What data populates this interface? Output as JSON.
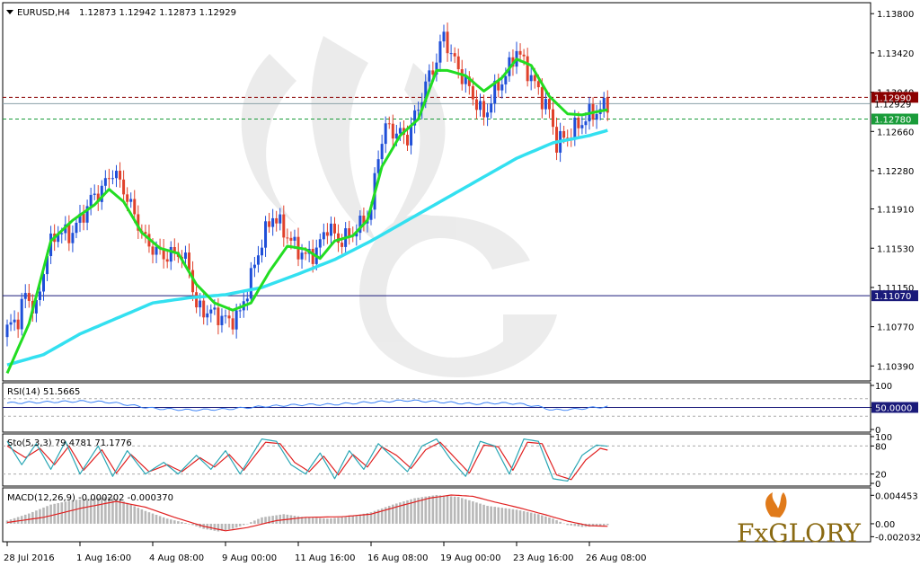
{
  "header": {
    "symbol": "EURUSD,H4",
    "ohlc": "1.12873 1.12942 1.12873 1.12929"
  },
  "brand": {
    "text": "FxGLORY"
  },
  "colors": {
    "bull": "#1f4fd8",
    "bear": "#e0412b",
    "ma_fast": "#22dd22",
    "ma_slow": "#33e0f0",
    "resistance": "#8b0000",
    "support_dashed": "#1a9c3a",
    "support_solid": "#1a1a7a",
    "rsi": "#3b82f6",
    "sto_main": "#2aa7b5",
    "sto_signal": "#e02020",
    "macd_hist": "#b8b8b8",
    "macd_signal": "#e02020"
  },
  "chart_data": [
    {
      "type": "candlestick",
      "ylim": [
        1.1028,
        1.1388
      ],
      "y_ticks": [
        "1.13800",
        "1.13420",
        "1.13040",
        "1.12660",
        "1.12280",
        "1.11910",
        "1.11530",
        "1.11150",
        "1.10770",
        "1.10390"
      ],
      "y_tick_values": [
        1.138,
        1.1342,
        1.1304,
        1.1266,
        1.1228,
        1.1191,
        1.1153,
        1.1115,
        1.1077,
        1.1039
      ],
      "x_ticks": [
        "28 Jul 2016",
        "1 Aug 16:00",
        "4 Aug 08:00",
        "9 Aug 00:00",
        "11 Aug 16:00",
        "16 Aug 08:00",
        "19 Aug 00:00",
        "23 Aug 16:00",
        "26 Aug 08:00"
      ],
      "x_tick_index": [
        0,
        20,
        40,
        60,
        80,
        100,
        120,
        140,
        160
      ],
      "levels": [
        {
          "name": "resistance",
          "value": 1.1299,
          "label": "1.12990",
          "style": "dashed"
        },
        {
          "name": "current",
          "value": 1.12929,
          "label": "1.12929",
          "style": "solid"
        },
        {
          "name": "support",
          "value": 1.1278,
          "label": "1.12780",
          "style": "dashed"
        },
        {
          "name": "support-2",
          "value": 1.1107,
          "label": "1.11070",
          "style": "solid"
        }
      ],
      "anchors": {
        "close": [
          [
            0,
            1.1075
          ],
          [
            3,
            1.1085
          ],
          [
            5,
            1.1108
          ],
          [
            8,
            1.1093
          ],
          [
            11,
            1.115
          ],
          [
            14,
            1.117
          ],
          [
            17,
            1.1165
          ],
          [
            20,
            1.118
          ],
          [
            23,
            1.12
          ],
          [
            26,
            1.121
          ],
          [
            29,
            1.1228
          ],
          [
            32,
            1.121
          ],
          [
            35,
            1.1185
          ],
          [
            38,
            1.116
          ],
          [
            41,
            1.115
          ],
          [
            44,
            1.1145
          ],
          [
            47,
            1.115
          ],
          [
            50,
            1.1135
          ],
          [
            52,
            1.1095
          ],
          [
            55,
            1.1092
          ],
          [
            58,
            1.1088
          ],
          [
            61,
            1.1082
          ],
          [
            64,
            1.109
          ],
          [
            67,
            1.1125
          ],
          [
            70,
            1.116
          ],
          [
            73,
            1.1185
          ],
          [
            76,
            1.117
          ],
          [
            79,
            1.1155
          ],
          [
            82,
            1.1145
          ],
          [
            85,
            1.115
          ],
          [
            88,
            1.1175
          ],
          [
            91,
            1.116
          ],
          [
            94,
            1.1165
          ],
          [
            97,
            1.1175
          ],
          [
            100,
            1.119
          ],
          [
            102,
            1.1245
          ],
          [
            104,
            1.127
          ],
          [
            107,
            1.1265
          ],
          [
            110,
            1.126
          ],
          [
            113,
            1.129
          ],
          [
            116,
            1.132
          ],
          [
            118,
            1.1335
          ],
          [
            120,
            1.136
          ],
          [
            122,
            1.134
          ],
          [
            125,
            1.132
          ],
          [
            128,
            1.13
          ],
          [
            131,
            1.128
          ],
          [
            134,
            1.1305
          ],
          [
            137,
            1.132
          ],
          [
            140,
            1.1345
          ],
          [
            143,
            1.1325
          ],
          [
            146,
            1.1305
          ],
          [
            149,
            1.1285
          ],
          [
            151,
            1.1255
          ],
          [
            154,
            1.1262
          ],
          [
            157,
            1.1272
          ],
          [
            160,
            1.1282
          ],
          [
            163,
            1.1287
          ],
          [
            165,
            1.1293
          ]
        ],
        "ma_fast": [
          [
            0,
            1.1032
          ],
          [
            6,
            1.108
          ],
          [
            12,
            1.116
          ],
          [
            18,
            1.118
          ],
          [
            24,
            1.1195
          ],
          [
            28,
            1.121
          ],
          [
            32,
            1.1198
          ],
          [
            37,
            1.1168
          ],
          [
            42,
            1.1153
          ],
          [
            47,
            1.1148
          ],
          [
            52,
            1.1118
          ],
          [
            57,
            1.11
          ],
          [
            62,
            1.1093
          ],
          [
            67,
            1.11
          ],
          [
            72,
            1.113
          ],
          [
            77,
            1.1155
          ],
          [
            82,
            1.1152
          ],
          [
            86,
            1.1143
          ],
          [
            90,
            1.116
          ],
          [
            95,
            1.1165
          ],
          [
            99,
            1.118
          ],
          [
            103,
            1.1232
          ],
          [
            108,
            1.1262
          ],
          [
            113,
            1.1278
          ],
          [
            118,
            1.1325
          ],
          [
            121,
            1.1325
          ],
          [
            126,
            1.132
          ],
          [
            131,
            1.1305
          ],
          [
            136,
            1.1318
          ],
          [
            140,
            1.1336
          ],
          [
            144,
            1.133
          ],
          [
            149,
            1.13
          ],
          [
            154,
            1.1283
          ],
          [
            158,
            1.1282
          ],
          [
            162,
            1.1285
          ],
          [
            165,
            1.1287
          ]
        ],
        "ma_slow": [
          [
            0,
            1.104
          ],
          [
            10,
            1.105
          ],
          [
            20,
            1.107
          ],
          [
            30,
            1.1085
          ],
          [
            40,
            1.11
          ],
          [
            50,
            1.1105
          ],
          [
            60,
            1.1108
          ],
          [
            70,
            1.1115
          ],
          [
            80,
            1.1128
          ],
          [
            90,
            1.1142
          ],
          [
            100,
            1.116
          ],
          [
            110,
            1.118
          ],
          [
            120,
            1.12
          ],
          [
            130,
            1.122
          ],
          [
            140,
            1.124
          ],
          [
            150,
            1.1255
          ],
          [
            160,
            1.1262
          ],
          [
            165,
            1.1267
          ]
        ]
      },
      "candle_count": 166
    },
    {
      "type": "line",
      "name": "RSI(14)",
      "label": "RSI(14) 51.5665",
      "ylim": [
        0,
        100
      ],
      "y_ticks": [
        "100",
        "50.0000",
        "0"
      ],
      "levels": [
        70,
        50,
        30
      ],
      "anchors": [
        [
          0,
          60
        ],
        [
          10,
          62
        ],
        [
          20,
          64
        ],
        [
          28,
          62
        ],
        [
          34,
          55
        ],
        [
          40,
          48
        ],
        [
          50,
          44
        ],
        [
          60,
          46
        ],
        [
          70,
          52
        ],
        [
          80,
          56
        ],
        [
          90,
          57
        ],
        [
          100,
          62
        ],
        [
          110,
          66
        ],
        [
          120,
          62
        ],
        [
          128,
          58
        ],
        [
          134,
          60
        ],
        [
          140,
          59
        ],
        [
          146,
          52
        ],
        [
          150,
          44
        ],
        [
          156,
          46
        ],
        [
          160,
          49
        ],
        [
          165,
          51.6
        ]
      ]
    },
    {
      "type": "line",
      "name": "Sto(5,3,3)",
      "label": "Sto(5,3,3) 79.4781 71.1776",
      "ylim": [
        0,
        100
      ],
      "y_ticks": [
        "100",
        "80",
        "20",
        "0"
      ],
      "levels": [
        80,
        20
      ],
      "main_anchors": [
        [
          0,
          90
        ],
        [
          4,
          40
        ],
        [
          8,
          85
        ],
        [
          12,
          30
        ],
        [
          16,
          90
        ],
        [
          20,
          20
        ],
        [
          25,
          80
        ],
        [
          29,
          15
        ],
        [
          33,
          70
        ],
        [
          38,
          20
        ],
        [
          43,
          45
        ],
        [
          47,
          20
        ],
        [
          52,
          60
        ],
        [
          56,
          30
        ],
        [
          60,
          70
        ],
        [
          64,
          20
        ],
        [
          70,
          95
        ],
        [
          74,
          90
        ],
        [
          78,
          40
        ],
        [
          82,
          20
        ],
        [
          86,
          65
        ],
        [
          90,
          10
        ],
        [
          94,
          70
        ],
        [
          98,
          30
        ],
        [
          102,
          85
        ],
        [
          106,
          55
        ],
        [
          110,
          25
        ],
        [
          114,
          80
        ],
        [
          118,
          95
        ],
        [
          122,
          50
        ],
        [
          126,
          15
        ],
        [
          130,
          90
        ],
        [
          134,
          80
        ],
        [
          138,
          20
        ],
        [
          142,
          95
        ],
        [
          146,
          90
        ],
        [
          150,
          10
        ],
        [
          154,
          5
        ],
        [
          158,
          60
        ],
        [
          162,
          82
        ],
        [
          165,
          79.5
        ]
      ],
      "signal_anchors": [
        [
          0,
          80
        ],
        [
          5,
          55
        ],
        [
          9,
          75
        ],
        [
          13,
          40
        ],
        [
          17,
          80
        ],
        [
          21,
          28
        ],
        [
          26,
          72
        ],
        [
          30,
          22
        ],
        [
          34,
          62
        ],
        [
          39,
          25
        ],
        [
          44,
          40
        ],
        [
          48,
          25
        ],
        [
          53,
          55
        ],
        [
          57,
          35
        ],
        [
          61,
          62
        ],
        [
          65,
          28
        ],
        [
          71,
          88
        ],
        [
          75,
          85
        ],
        [
          79,
          45
        ],
        [
          83,
          25
        ],
        [
          87,
          58
        ],
        [
          91,
          18
        ],
        [
          95,
          62
        ],
        [
          99,
          35
        ],
        [
          103,
          78
        ],
        [
          107,
          60
        ],
        [
          111,
          32
        ],
        [
          115,
          72
        ],
        [
          119,
          88
        ],
        [
          123,
          55
        ],
        [
          127,
          22
        ],
        [
          131,
          82
        ],
        [
          135,
          78
        ],
        [
          139,
          28
        ],
        [
          143,
          88
        ],
        [
          147,
          85
        ],
        [
          151,
          18
        ],
        [
          155,
          8
        ],
        [
          159,
          50
        ],
        [
          163,
          75
        ],
        [
          165,
          71.2
        ]
      ]
    },
    {
      "type": "bar",
      "name": "MACD(12,26,9)",
      "label": "MACD(12,26,9) -0.000202 -0.000370",
      "ylim": [
        -0.0024,
        0.0052
      ],
      "y_ticks": [
        "0.004453",
        "0.00",
        "-0.002032"
      ],
      "y_tick_values": [
        0.004453,
        0.0,
        -0.002032
      ],
      "hist_anchors": [
        [
          0,
          0.0005
        ],
        [
          6,
          0.0016
        ],
        [
          12,
          0.003
        ],
        [
          18,
          0.0037
        ],
        [
          24,
          0.004
        ],
        [
          28,
          0.0042
        ],
        [
          32,
          0.0035
        ],
        [
          38,
          0.002
        ],
        [
          44,
          0.0008
        ],
        [
          50,
          0.0
        ],
        [
          54,
          -0.0008
        ],
        [
          58,
          -0.0012
        ],
        [
          62,
          -0.0008
        ],
        [
          66,
          0.0
        ],
        [
          70,
          0.001
        ],
        [
          76,
          0.0015
        ],
        [
          82,
          0.001
        ],
        [
          88,
          0.0008
        ],
        [
          94,
          0.0011
        ],
        [
          100,
          0.0018
        ],
        [
          106,
          0.003
        ],
        [
          112,
          0.004
        ],
        [
          118,
          0.0045
        ],
        [
          124,
          0.0042
        ],
        [
          128,
          0.0035
        ],
        [
          132,
          0.0028
        ],
        [
          136,
          0.0025
        ],
        [
          140,
          0.0022
        ],
        [
          146,
          0.0015
        ],
        [
          150,
          0.0008
        ],
        [
          154,
          -0.0002
        ],
        [
          158,
          -0.0005
        ],
        [
          162,
          -0.0004
        ],
        [
          165,
          -0.0002
        ]
      ],
      "signal_anchors": [
        [
          0,
          0.0002
        ],
        [
          10,
          0.001
        ],
        [
          20,
          0.0024
        ],
        [
          30,
          0.0035
        ],
        [
          38,
          0.0026
        ],
        [
          46,
          0.001
        ],
        [
          54,
          -0.0004
        ],
        [
          60,
          -0.0011
        ],
        [
          66,
          -0.0006
        ],
        [
          74,
          0.0005
        ],
        [
          82,
          0.001
        ],
        [
          92,
          0.0011
        ],
        [
          100,
          0.0015
        ],
        [
          108,
          0.0028
        ],
        [
          116,
          0.004
        ],
        [
          122,
          0.0045
        ],
        [
          128,
          0.0043
        ],
        [
          134,
          0.0034
        ],
        [
          140,
          0.0026
        ],
        [
          148,
          0.0014
        ],
        [
          154,
          0.0004
        ],
        [
          160,
          -0.0003
        ],
        [
          165,
          -0.0004
        ]
      ]
    }
  ]
}
